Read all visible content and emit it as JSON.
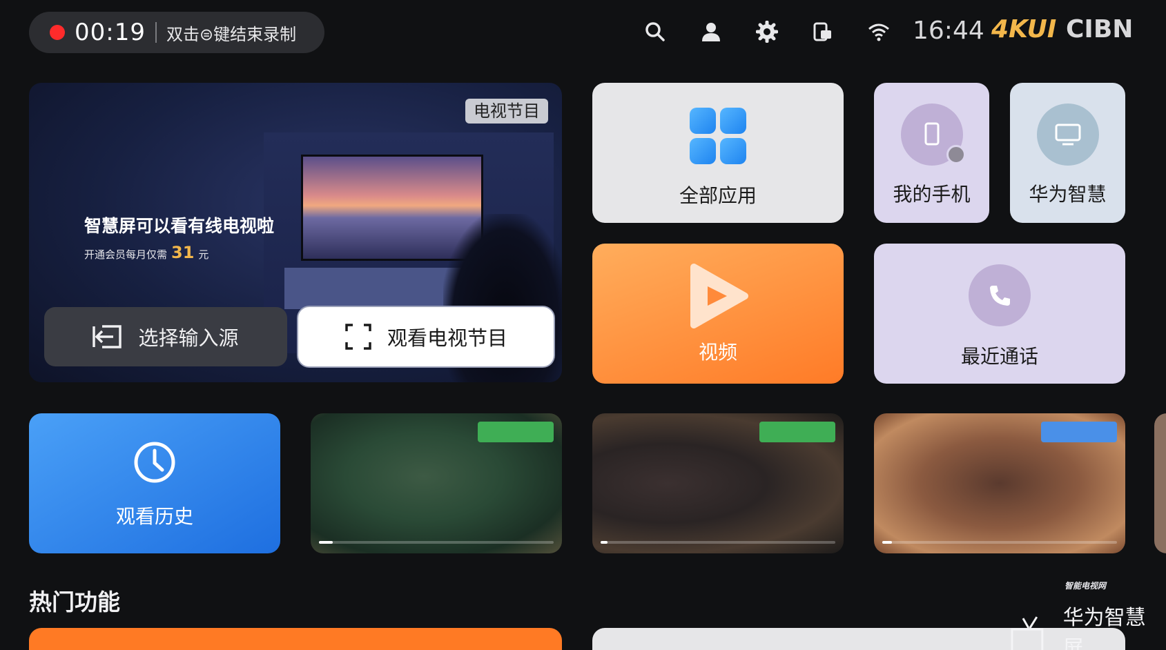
{
  "recording": {
    "time": "00:19",
    "hint": "双击⊜键结束录制"
  },
  "status_bar": {
    "icons": [
      "search-icon",
      "user-icon",
      "settings-icon",
      "screen-cast-icon",
      "wifi-icon"
    ],
    "clock": "16:44",
    "brand_4k": "4KUI",
    "brand_cibn": "CIBN"
  },
  "hero": {
    "tag": "电视节目",
    "title": "智慧屏可以看有线电视啦",
    "subtitle_prefix": "开通会员每月仅需",
    "price": "31",
    "price_unit": "元",
    "buttons": {
      "input_source": "选择输入源",
      "watch_tv": "观看电视节目"
    }
  },
  "tiles": {
    "all_apps": "全部应用",
    "my_phone": "我的手机",
    "huawei_smart": "华为智慧",
    "video": "视频",
    "recent_calls": "最近通话",
    "watch_history": "观看历史"
  },
  "thumbnails": [
    {
      "progress": 0.06
    },
    {
      "progress": 0.03
    },
    {
      "progress": 0.04
    }
  ],
  "sections": {
    "hot_features": "热门功能"
  },
  "watermark": {
    "small": "智能电视网",
    "large": "华为智慧屏"
  },
  "colors": {
    "accent_orange": "#ff7b27",
    "accent_blue": "#1e6fe0",
    "record_red": "#ff2b2b",
    "brand_gold": "#f3b74b"
  }
}
